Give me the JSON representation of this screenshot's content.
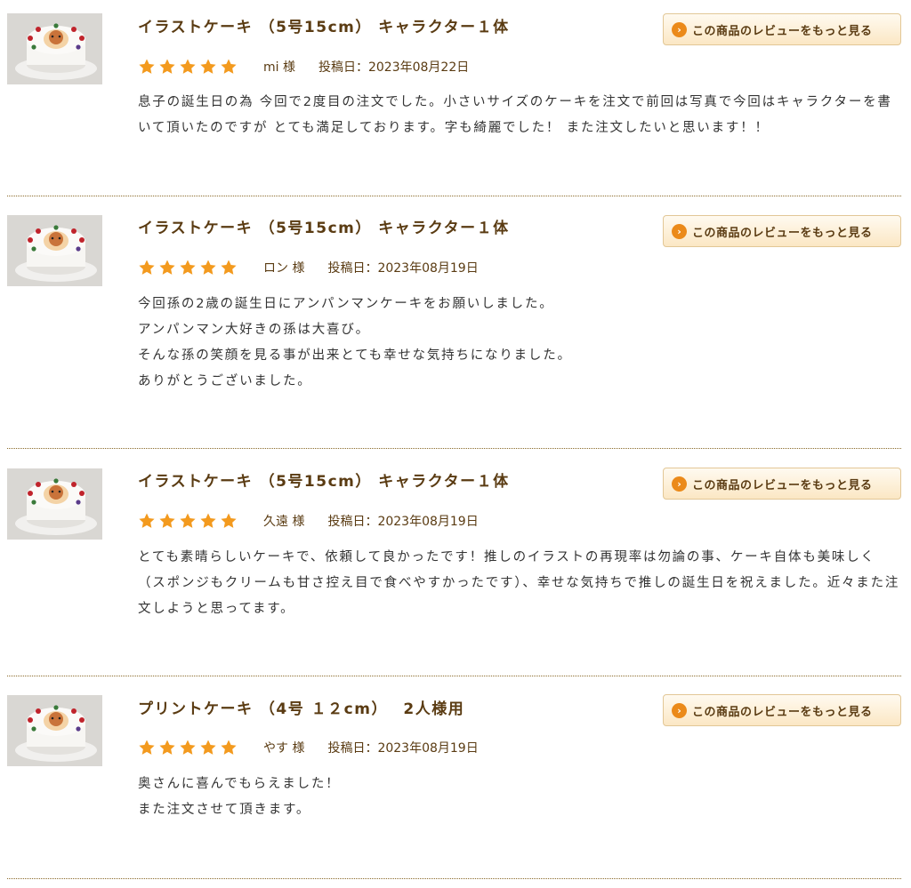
{
  "common": {
    "more_reviews_label": "この商品のレビューをもっと見る",
    "more_reviews_arrow": "›",
    "star_color": "#f39a1e",
    "accent_text": "#5a3b12"
  },
  "reviews": [
    {
      "title": "イラストケーキ （5号15cm） キャラクター１体",
      "rating": 5,
      "name": "mi 様",
      "date": "投稿日：2023年08月22日",
      "body": [
        "息子の誕生日の為 今回で2度目の注文でした。小さいサイズのケーキを注文で前回は写真で今回はキャラクターを書いて頂いたのですが とても満足しております。字も綺麗でした！ また注文したいと思います！！"
      ]
    },
    {
      "title": "イラストケーキ （5号15cm） キャラクター１体",
      "rating": 5,
      "name": "ロン 様",
      "date": "投稿日：2023年08月19日",
      "body": [
        "今回孫の2歳の誕生日にアンパンマンケーキをお願いしました。",
        "アンパンマン大好きの孫は大喜び。",
        "そんな孫の笑顔を見る事が出来とても幸せな気持ちになりました。",
        "ありがとうございました。"
      ]
    },
    {
      "title": "イラストケーキ （5号15cm） キャラクター１体",
      "rating": 5,
      "name": "久遠 様",
      "date": "投稿日：2023年08月19日",
      "body": [
        "とても素晴らしいケーキで、依頼して良かったです！推しのイラストの再現率は勿論の事、ケーキ自体も美味しく（スポンジもクリームも甘さ控え目で食べやすかったです）、幸せな気持ちで推しの誕生日を祝えました。近々また注文しようと思ってます。"
      ]
    },
    {
      "title": "プリントケーキ （4号 １２cm）　 2人様用",
      "rating": 5,
      "name": "やす 様",
      "date": "投稿日：2023年08月19日",
      "body": [
        "奥さんに喜んでもらえました！",
        "また注文させて頂きます。"
      ]
    }
  ]
}
